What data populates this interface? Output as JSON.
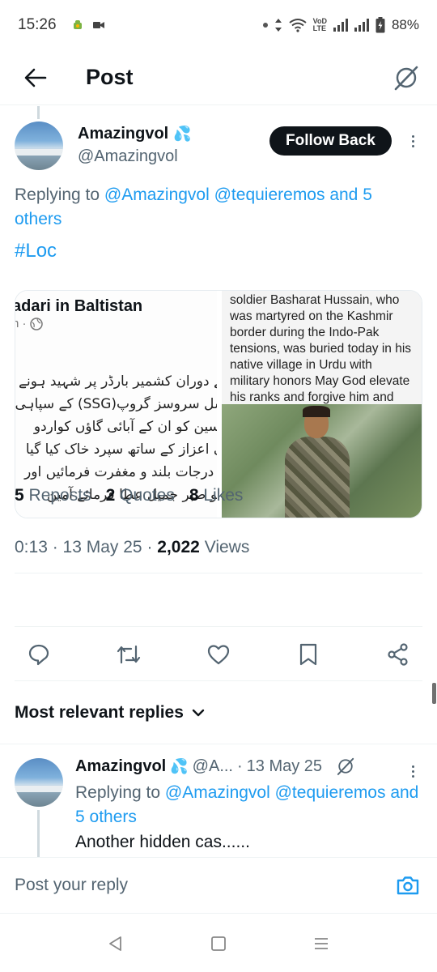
{
  "status_bar": {
    "time": "15:26",
    "battery": "88%",
    "icons": [
      "android-debug-icon",
      "video-icon",
      "dot-icon",
      "data-arrows-icon",
      "wifi-icon",
      "volte-icon",
      "signal-icon",
      "signal-icon",
      "battery-icon"
    ]
  },
  "header": {
    "title": "Post",
    "back_icon": "arrow-left-icon",
    "grok_icon": "grok-icon"
  },
  "post": {
    "author_name": "Amazingvol",
    "author_emoji": "💦",
    "author_handle": "@Amazingvol",
    "follow_label": "Follow Back",
    "replying_prefix": "Replying to ",
    "replying_mentions": "@Amazingvol @tequieremos and 5 others",
    "hashtag": "#Loc",
    "media": {
      "left_title": "adari in Baltistan",
      "left_meta": "n ·",
      "left_urdu": "شیدگی کے دوران کشمیر بارڈر پر شہید ہونے والے سپیشل سروسز گروپ(SSG) کے سپاہی بشارت حسین کو ان کے آبائی گاؤں کواردو میں فوجی اعزاز کے ساتھ سپرد خاک کیا گیا اللہ تعالیٰ درجات بلند و مغفرت فرمائیں اور لواحقین کو صبر جمیل عطا فرمائے آمین",
      "right_text": "soldier Basharat Hussain, who was martyred on the Kashmir border during the Indo-Pak tensions, was buried today in his native village in Urdu with military honors May God elevate his ranks and forgive him and grant patience"
    },
    "time": "0:13",
    "date": "13 May 25",
    "views_count": "2,022",
    "views_label": "Views",
    "reposts_count": "5",
    "reposts_label": "Reposts",
    "quotes_count": "2",
    "quotes_label": "Quotes",
    "likes_count": "8",
    "likes_label": "Likes",
    "actions": [
      "reply-icon",
      "repost-icon",
      "like-icon",
      "bookmark-icon",
      "share-icon"
    ]
  },
  "sort": {
    "label": "Most relevant replies"
  },
  "reply": {
    "author_name": "Amazingvol",
    "author_emoji": "💦",
    "author_handle": "@A...",
    "date": "13 May 25",
    "replying_prefix": "Replying to ",
    "replying_mentions": "@Amazingvol @tequieremos and 5 others",
    "text": "Another hidden cas......"
  },
  "composer": {
    "placeholder": "Post your reply"
  },
  "navbar": [
    "back-triangle-icon",
    "home-square-icon",
    "menu-lines-icon"
  ],
  "colors": {
    "accent": "#1d9bf0",
    "text": "#0f1419",
    "secondary": "#536471"
  }
}
